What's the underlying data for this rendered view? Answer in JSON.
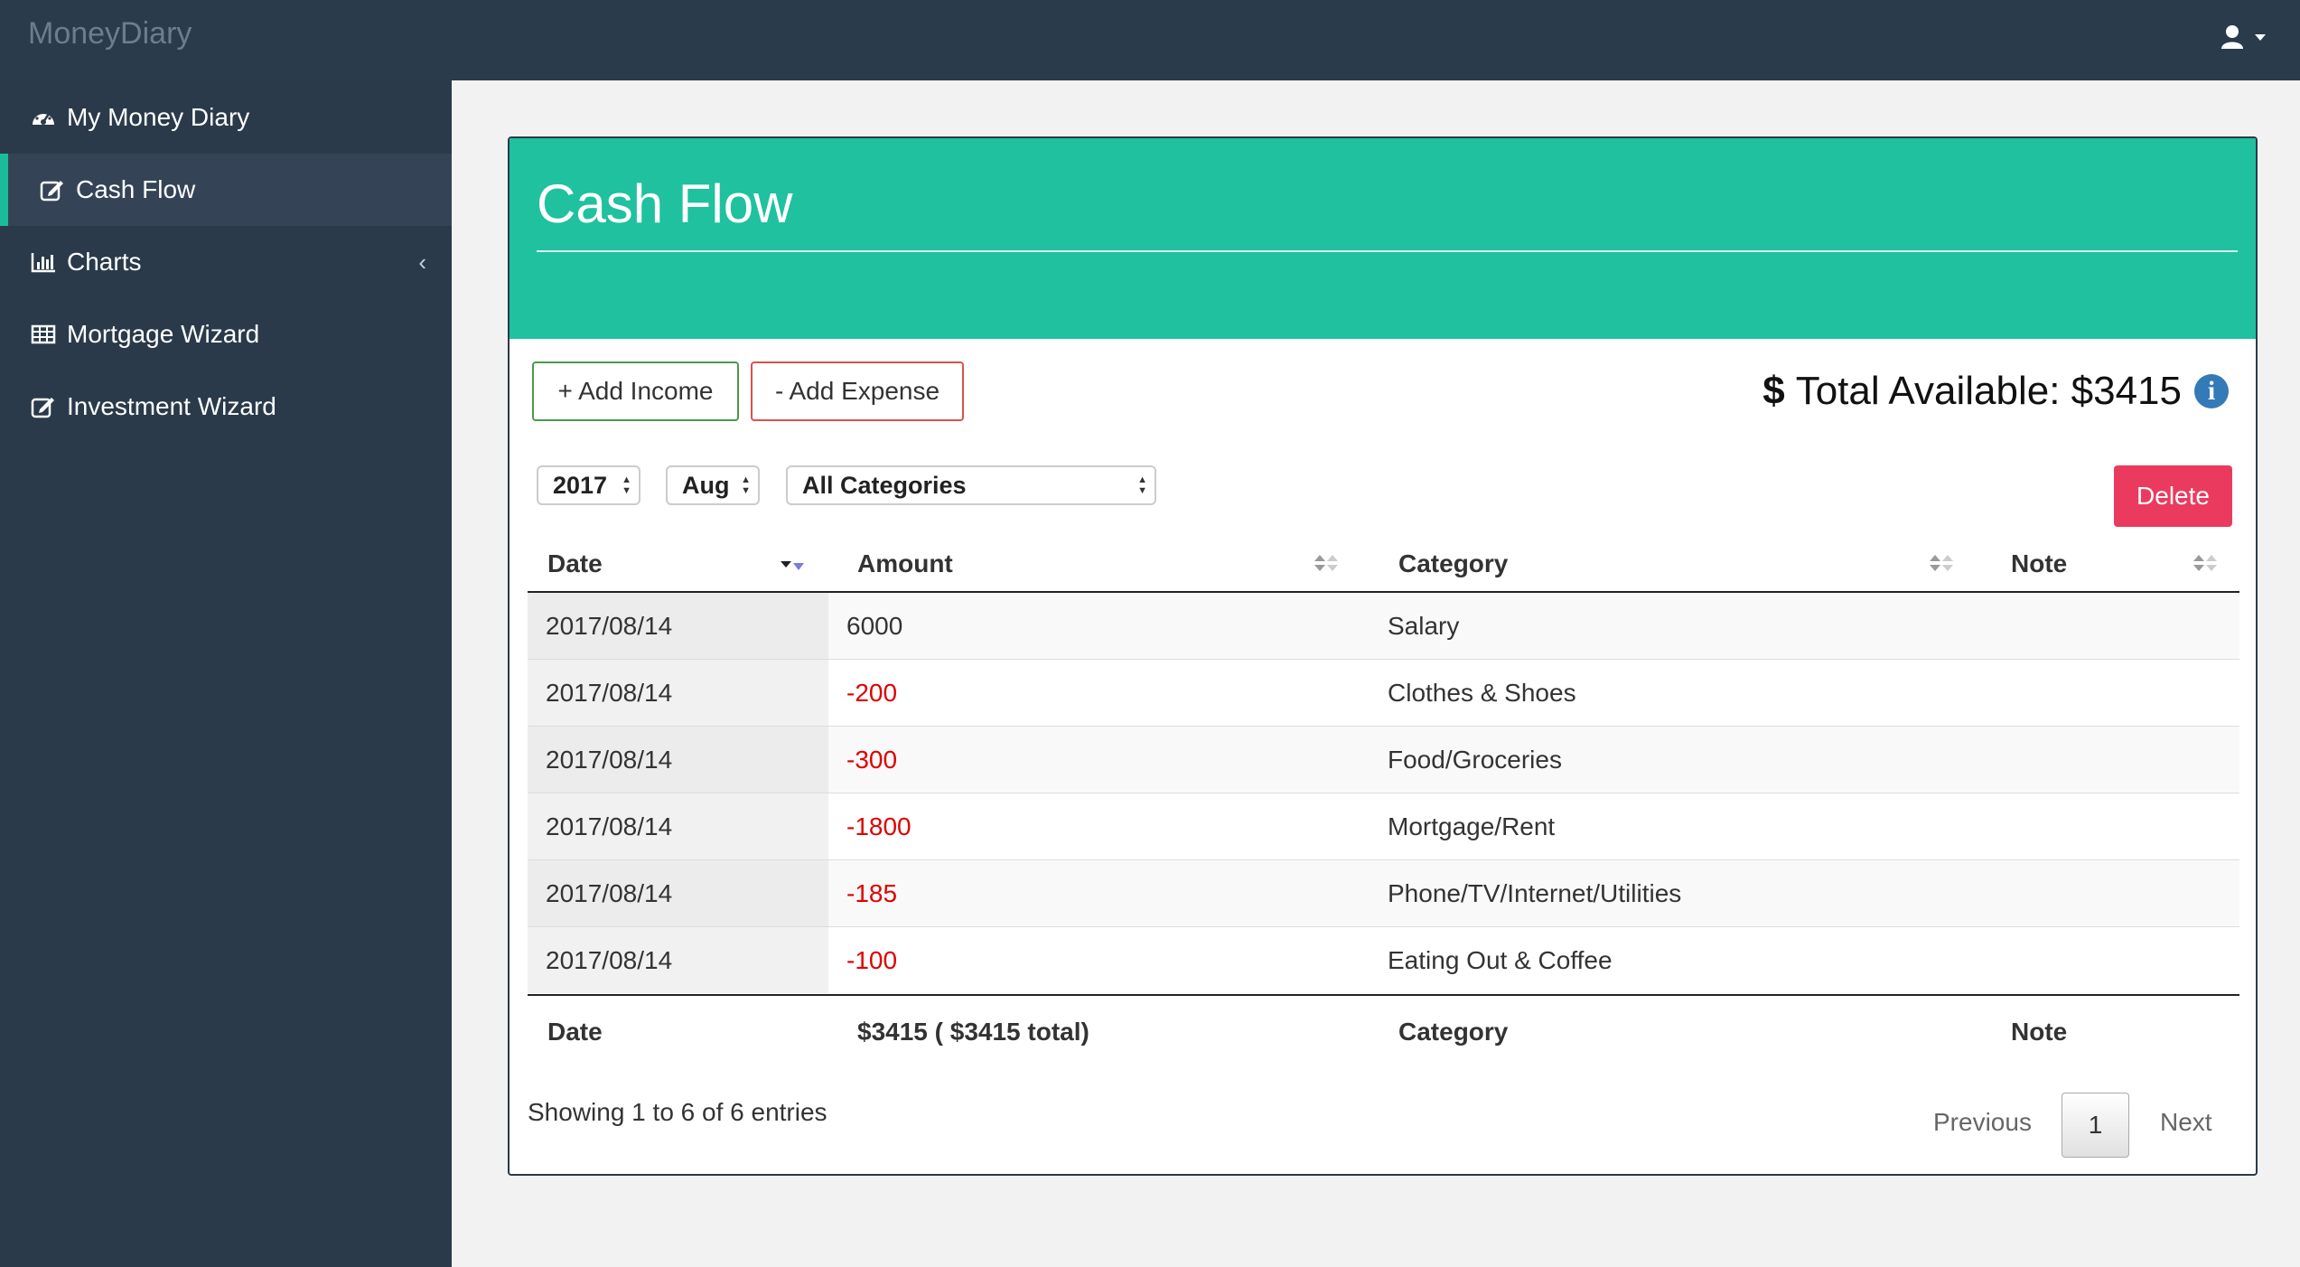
{
  "app": {
    "brand": "MoneyDiary"
  },
  "colors": {
    "accent": "#1fc19f",
    "sidebar": "#2a3a4a",
    "danger": "#ea3b5f",
    "negative": "#e00000"
  },
  "sidebar": {
    "items": [
      {
        "label": "My Money Diary",
        "icon": "dashboard-icon"
      },
      {
        "label": "Cash Flow",
        "icon": "edit-icon",
        "active": true
      },
      {
        "label": "Charts",
        "icon": "bar-chart-icon",
        "expandable": true
      },
      {
        "label": "Mortgage Wizard",
        "icon": "table-icon"
      },
      {
        "label": "Investment Wizard",
        "icon": "edit-icon"
      }
    ]
  },
  "panel": {
    "title": "Cash Flow",
    "add_income": "+ Add Income",
    "add_expense": "- Add Expense",
    "total_label": "Total Available: $3415",
    "delete": "Delete"
  },
  "filters": {
    "year": "2017",
    "month": "Aug",
    "category": "All Categories"
  },
  "table": {
    "headers": [
      "Date",
      "Amount",
      "Category",
      "Note"
    ],
    "rows": [
      {
        "date": "2017/08/14",
        "amount": "6000",
        "category": "Salary",
        "note": ""
      },
      {
        "date": "2017/08/14",
        "amount": "-200",
        "category": "Clothes & Shoes",
        "note": ""
      },
      {
        "date": "2017/08/14",
        "amount": "-300",
        "category": "Food/Groceries",
        "note": ""
      },
      {
        "date": "2017/08/14",
        "amount": "-1800",
        "category": "Mortgage/Rent",
        "note": ""
      },
      {
        "date": "2017/08/14",
        "amount": "-185",
        "category": "Phone/TV/Internet/Utilities",
        "note": ""
      },
      {
        "date": "2017/08/14",
        "amount": "-100",
        "category": "Eating Out & Coffee",
        "note": ""
      }
    ],
    "footer": [
      "Date",
      "$3415 ( $3415 total)",
      "Category",
      "Note"
    ]
  },
  "pagination": {
    "info": "Showing 1 to 6 of 6 entries",
    "previous": "Previous",
    "page": "1",
    "next": "Next"
  }
}
